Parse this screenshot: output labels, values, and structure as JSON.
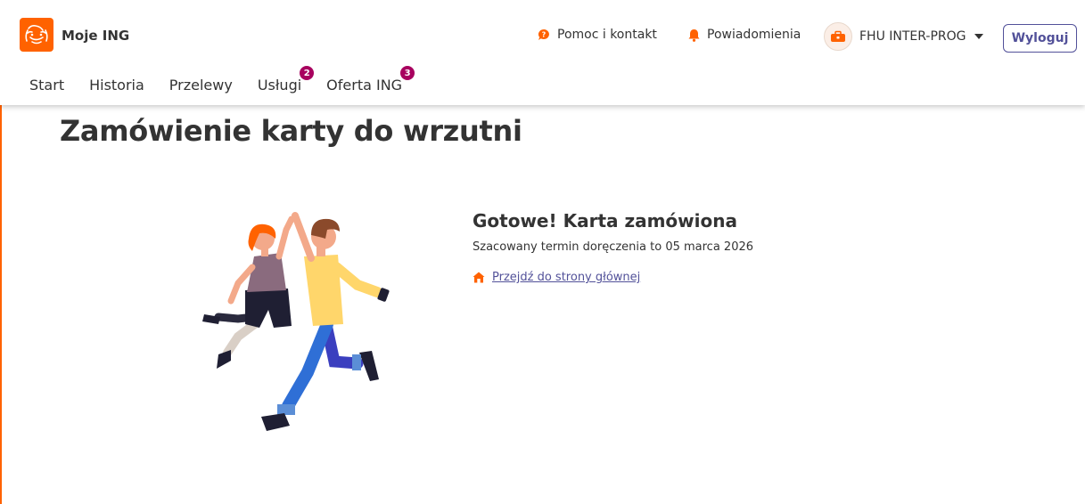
{
  "brand": {
    "name": "Moje ING",
    "accent": "#ff6200",
    "link_color": "#525199",
    "badge_color": "#a8005f"
  },
  "header": {
    "help": "Pomoc i kontakt",
    "notifications": "Powiadomienia",
    "account_name": "FHU INTER-PROG",
    "logout": "Wyloguj"
  },
  "nav": {
    "items": [
      {
        "label": "Start"
      },
      {
        "label": "Historia"
      },
      {
        "label": "Przelewy"
      },
      {
        "label": "Usługi",
        "badge": "2"
      },
      {
        "label": "Oferta ING",
        "badge": "3"
      }
    ]
  },
  "main": {
    "title": "Zamówienie karty do wrzutni",
    "success_title": "Gotowe! Karta zamówiona",
    "delivery_text": "Szacowany termin doręczenia to 05 marca 2026",
    "home_link": "Przejdź do strony głównej"
  },
  "icons": {
    "help": "chat-bubble-question-icon",
    "notifications": "bell-icon",
    "account": "briefcase-avatar-icon",
    "dropdown": "caret-down-icon",
    "home": "home-icon"
  }
}
